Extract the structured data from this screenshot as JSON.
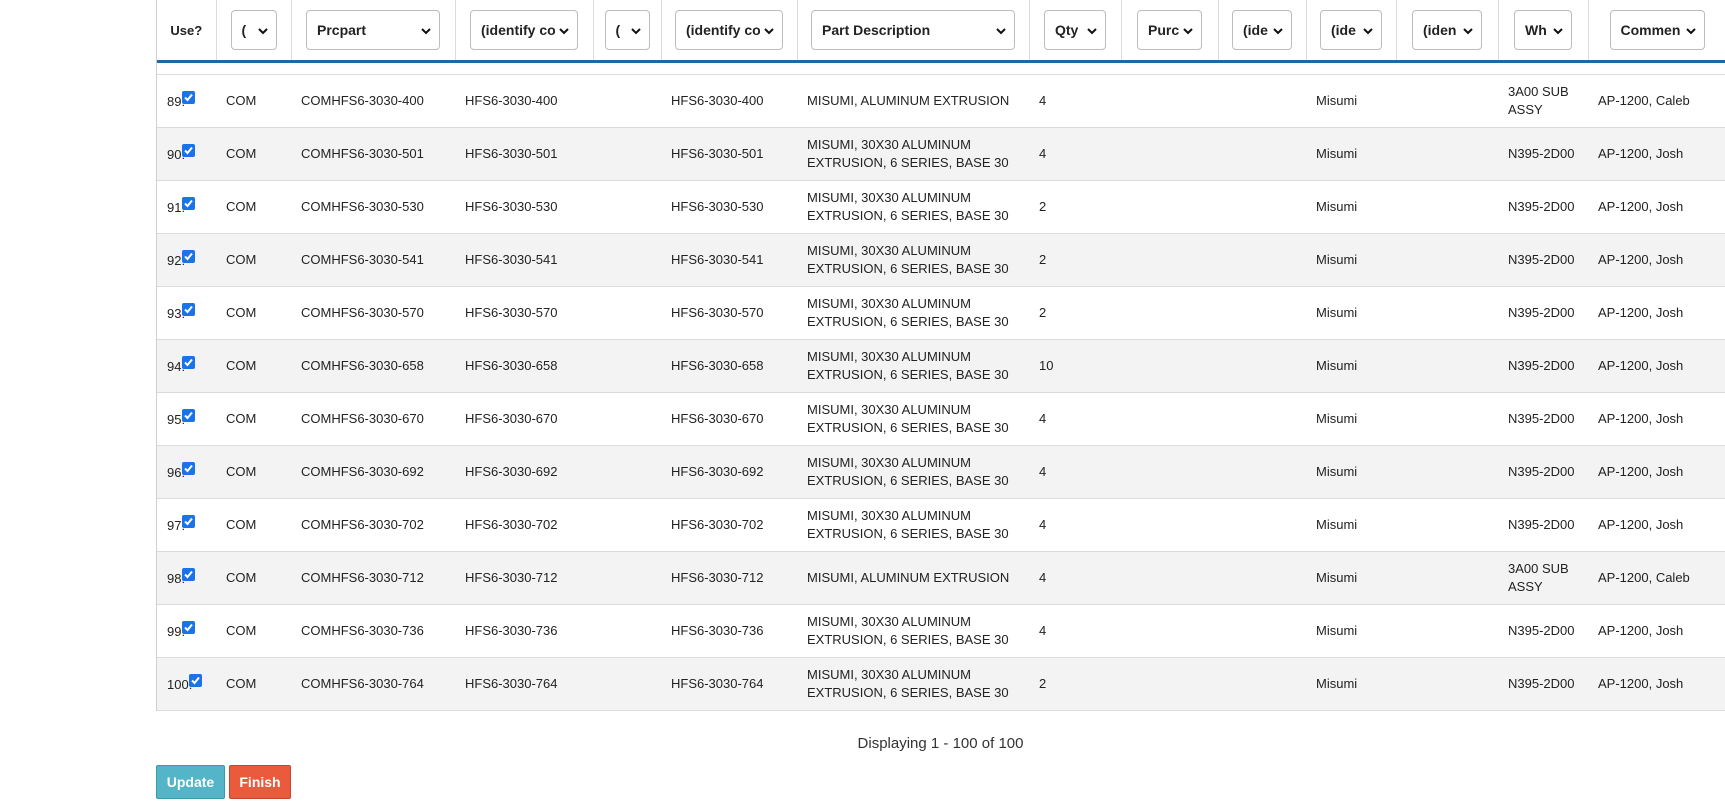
{
  "headers": [
    {
      "label": "Use?",
      "kind": "text"
    },
    {
      "label": "(",
      "kind": "select"
    },
    {
      "label": "Prcpart",
      "kind": "select"
    },
    {
      "label": "(identify co",
      "kind": "select"
    },
    {
      "label": "(",
      "kind": "select"
    },
    {
      "label": "(identify co",
      "kind": "select"
    },
    {
      "label": "Part Description",
      "kind": "select"
    },
    {
      "label": "Qty",
      "kind": "select"
    },
    {
      "label": "Purc",
      "kind": "select"
    },
    {
      "label": "(ide",
      "kind": "select"
    },
    {
      "label": "(ide",
      "kind": "select"
    },
    {
      "label": "(iden",
      "kind": "select"
    },
    {
      "label": "Wh",
      "kind": "select"
    },
    {
      "label": "Commen",
      "kind": "select"
    }
  ],
  "rows": [
    {
      "num": "89:",
      "c1": "COM",
      "prcpart": "COMHFS6-3030-400",
      "id1": "HFS6-3030-400",
      "c4": "",
      "id2": "HFS6-3030-400",
      "desc": "MISUMI, ALUMINUM EXTRUSION",
      "qty": "4",
      "purc": "",
      "ide1": "",
      "vendor": "Misumi",
      "iden": "",
      "wh": "3A00 SUB ASSY",
      "comment": "AP-1200, Caleb"
    },
    {
      "num": "90:",
      "c1": "COM",
      "prcpart": "COMHFS6-3030-501",
      "id1": "HFS6-3030-501",
      "c4": "",
      "id2": "HFS6-3030-501",
      "desc": "MISUMI, 30X30 ALUMINUM EXTRUSION, 6 SERIES, BASE 30",
      "qty": "4",
      "purc": "",
      "ide1": "",
      "vendor": "Misumi",
      "iden": "",
      "wh": "N395-2D00",
      "comment": "AP-1200, Josh"
    },
    {
      "num": "91:",
      "c1": "COM",
      "prcpart": "COMHFS6-3030-530",
      "id1": "HFS6-3030-530",
      "c4": "",
      "id2": "HFS6-3030-530",
      "desc": "MISUMI, 30X30 ALUMINUM EXTRUSION, 6 SERIES, BASE 30",
      "qty": "2",
      "purc": "",
      "ide1": "",
      "vendor": "Misumi",
      "iden": "",
      "wh": "N395-2D00",
      "comment": "AP-1200, Josh"
    },
    {
      "num": "92:",
      "c1": "COM",
      "prcpart": "COMHFS6-3030-541",
      "id1": "HFS6-3030-541",
      "c4": "",
      "id2": "HFS6-3030-541",
      "desc": "MISUMI, 30X30 ALUMINUM EXTRUSION, 6 SERIES, BASE 30",
      "qty": "2",
      "purc": "",
      "ide1": "",
      "vendor": "Misumi",
      "iden": "",
      "wh": "N395-2D00",
      "comment": "AP-1200, Josh"
    },
    {
      "num": "93:",
      "c1": "COM",
      "prcpart": "COMHFS6-3030-570",
      "id1": "HFS6-3030-570",
      "c4": "",
      "id2": "HFS6-3030-570",
      "desc": "MISUMI, 30X30 ALUMINUM EXTRUSION, 6 SERIES, BASE 30",
      "qty": "2",
      "purc": "",
      "ide1": "",
      "vendor": "Misumi",
      "iden": "",
      "wh": "N395-2D00",
      "comment": "AP-1200, Josh"
    },
    {
      "num": "94:",
      "c1": "COM",
      "prcpart": "COMHFS6-3030-658",
      "id1": "HFS6-3030-658",
      "c4": "",
      "id2": "HFS6-3030-658",
      "desc": "MISUMI, 30X30 ALUMINUM EXTRUSION, 6 SERIES, BASE 30",
      "qty": "10",
      "purc": "",
      "ide1": "",
      "vendor": "Misumi",
      "iden": "",
      "wh": "N395-2D00",
      "comment": "AP-1200, Josh"
    },
    {
      "num": "95:",
      "c1": "COM",
      "prcpart": "COMHFS6-3030-670",
      "id1": "HFS6-3030-670",
      "c4": "",
      "id2": "HFS6-3030-670",
      "desc": "MISUMI, 30X30 ALUMINUM EXTRUSION, 6 SERIES, BASE 30",
      "qty": "4",
      "purc": "",
      "ide1": "",
      "vendor": "Misumi",
      "iden": "",
      "wh": "N395-2D00",
      "comment": "AP-1200, Josh"
    },
    {
      "num": "96:",
      "c1": "COM",
      "prcpart": "COMHFS6-3030-692",
      "id1": "HFS6-3030-692",
      "c4": "",
      "id2": "HFS6-3030-692",
      "desc": "MISUMI, 30X30 ALUMINUM EXTRUSION, 6 SERIES, BASE 30",
      "qty": "4",
      "purc": "",
      "ide1": "",
      "vendor": "Misumi",
      "iden": "",
      "wh": "N395-2D00",
      "comment": "AP-1200, Josh"
    },
    {
      "num": "97:",
      "c1": "COM",
      "prcpart": "COMHFS6-3030-702",
      "id1": "HFS6-3030-702",
      "c4": "",
      "id2": "HFS6-3030-702",
      "desc": "MISUMI, 30X30 ALUMINUM EXTRUSION, 6 SERIES, BASE 30",
      "qty": "4",
      "purc": "",
      "ide1": "",
      "vendor": "Misumi",
      "iden": "",
      "wh": "N395-2D00",
      "comment": "AP-1200, Josh"
    },
    {
      "num": "98:",
      "c1": "COM",
      "prcpart": "COMHFS6-3030-712",
      "id1": "HFS6-3030-712",
      "c4": "",
      "id2": "HFS6-3030-712",
      "desc": "MISUMI, ALUMINUM EXTRUSION",
      "qty": "4",
      "purc": "",
      "ide1": "",
      "vendor": "Misumi",
      "iden": "",
      "wh": "3A00 SUB ASSY",
      "comment": "AP-1200, Caleb"
    },
    {
      "num": "99:",
      "c1": "COM",
      "prcpart": "COMHFS6-3030-736",
      "id1": "HFS6-3030-736",
      "c4": "",
      "id2": "HFS6-3030-736",
      "desc": "MISUMI, 30X30 ALUMINUM EXTRUSION, 6 SERIES, BASE 30",
      "qty": "4",
      "purc": "",
      "ide1": "",
      "vendor": "Misumi",
      "iden": "",
      "wh": "N395-2D00",
      "comment": "AP-1200, Josh"
    },
    {
      "num": "100:",
      "c1": "COM",
      "prcpart": "COMHFS6-3030-764",
      "id1": "HFS6-3030-764",
      "c4": "",
      "id2": "HFS6-3030-764",
      "desc": "MISUMI, 30X30 ALUMINUM EXTRUSION, 6 SERIES, BASE 30",
      "qty": "2",
      "purc": "",
      "ide1": "",
      "vendor": "Misumi",
      "iden": "",
      "wh": "N395-2D00",
      "comment": "AP-1200, Josh"
    }
  ],
  "checkbox_state": "checked",
  "pager": {
    "text": "Displaying 1 - 100 of 100"
  },
  "buttons": {
    "update": "Update",
    "finish": "Finish"
  },
  "colors": {
    "accent": "#1e6aa0",
    "checkbox": "#1a73e8",
    "update": "#54b4c8",
    "finish": "#ea5a3c"
  }
}
